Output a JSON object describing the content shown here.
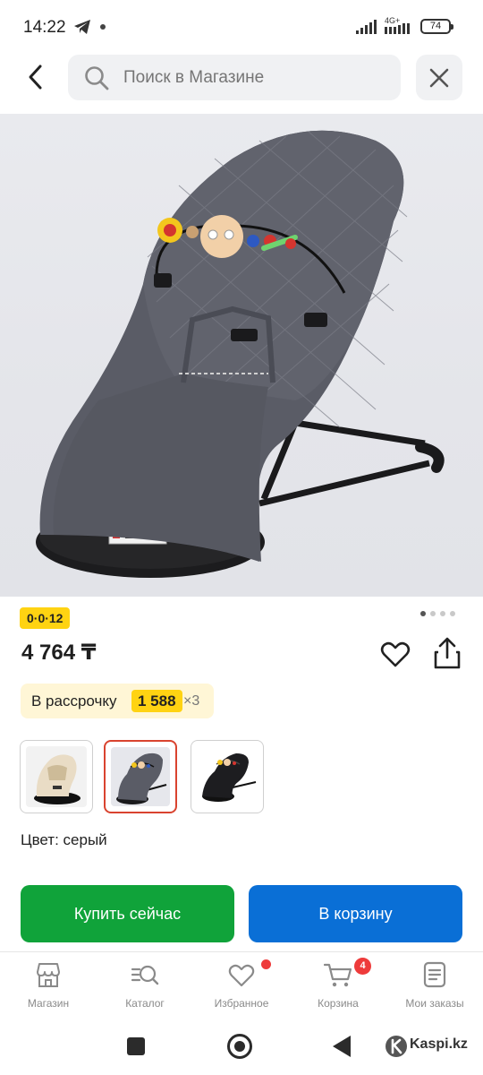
{
  "status_bar": {
    "time": "14:22",
    "network": "4G+",
    "battery": "74"
  },
  "search": {
    "placeholder": "Поиск в Магазине"
  },
  "product": {
    "badge": "0·0·12",
    "price": "4 764 ₸",
    "installment": {
      "label": "В рассрочку",
      "amount": "1 588",
      "multiplier": "×3"
    },
    "color_label": "Цвет: серый",
    "colors": [
      "beige",
      "grey",
      "black"
    ],
    "selected_color_index": 1,
    "images_count": 4,
    "active_image_index": 0
  },
  "actions": {
    "buy_now": "Купить сейчас",
    "add_to_cart": "В корзину"
  },
  "bottom_nav": {
    "items": [
      {
        "label": "Магазин",
        "icon": "shop-icon"
      },
      {
        "label": "Каталог",
        "icon": "catalog-search-icon"
      },
      {
        "label": "Избранное",
        "icon": "heart-icon"
      },
      {
        "label": "Корзина",
        "icon": "cart-icon"
      },
      {
        "label": "Мои заказы",
        "icon": "orders-icon"
      }
    ],
    "cart_badge": "4"
  },
  "watermark": "Kaspi.kz",
  "colors": {
    "buy_button": "#10a33a",
    "cart_button": "#0a6fd6",
    "promo_yellow": "#ffd312",
    "selected_border": "#d9432f",
    "notification_red": "#ee3b3b"
  }
}
